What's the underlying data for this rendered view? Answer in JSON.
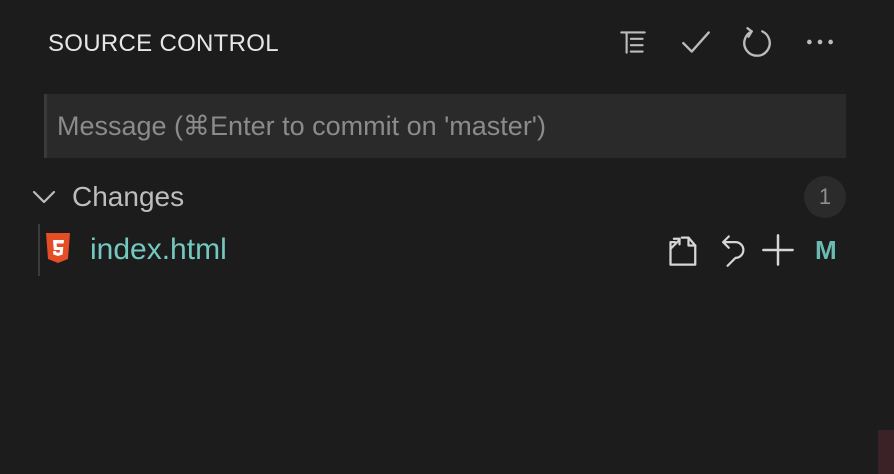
{
  "header": {
    "title": "SOURCE CONTROL",
    "actions": [
      {
        "icon": "tree-view-icon"
      },
      {
        "icon": "checkmark-icon"
      },
      {
        "icon": "refresh-icon"
      },
      {
        "icon": "more-icon"
      }
    ]
  },
  "commit": {
    "placeholder": "Message (⌘Enter to commit on 'master')",
    "value": ""
  },
  "changes": {
    "label": "Changes",
    "count": "1",
    "files": [
      {
        "name": "index.html",
        "icon": "html5-icon",
        "status": "M",
        "actions": [
          "open-file-icon",
          "discard-icon",
          "stage-icon"
        ]
      }
    ]
  },
  "colors": {
    "background": "#1c1c1c",
    "filename": "#73c8c0",
    "status_modified": "#6bbbb3",
    "html_icon": "#e44d26"
  }
}
